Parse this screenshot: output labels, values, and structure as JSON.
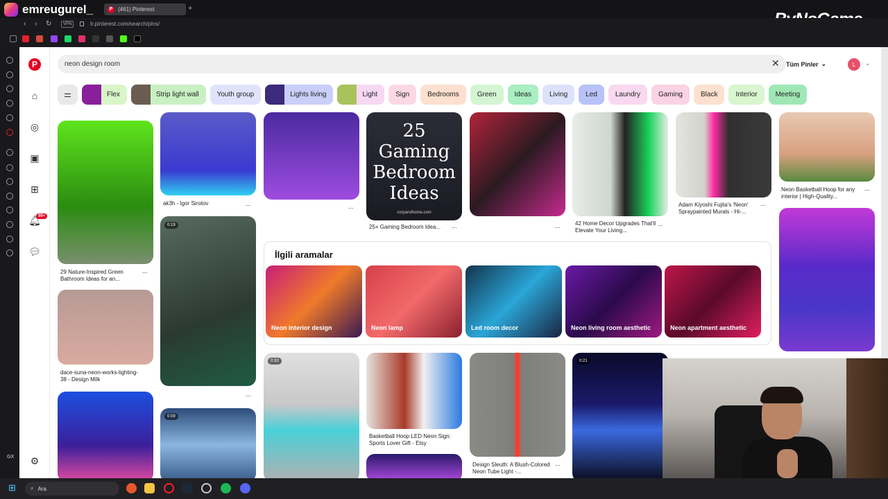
{
  "stream": {
    "channel": "emreugurel_",
    "overlay_brand": "ByNoGame"
  },
  "browser": {
    "tab_title": "(461) Pinterest",
    "new_tab": "+",
    "vpn": "VPN",
    "url": "tr.pinterest.com/search/pins/"
  },
  "pinterest": {
    "logo": "P",
    "search": {
      "value": "neon design room",
      "clear": "✕"
    },
    "filter_select": {
      "label": "Tüm Pinler",
      "chevron": "⌄"
    },
    "avatar": "L",
    "notifications_badge": "99+",
    "chips": [
      {
        "label": "Flex",
        "bg": "#d9f6c8",
        "thumb": "#8a1f9c"
      },
      {
        "label": "Strip light wall",
        "bg": "#c9f0c2",
        "thumb": "#6a5c50"
      },
      {
        "label": "Youth group",
        "bg": "#e0e3fb",
        "thumb": ""
      },
      {
        "label": "Lights living",
        "bg": "#c9cff8",
        "thumb": "#3c2a7a"
      },
      {
        "label": "Light",
        "bg": "#f7d8f3",
        "thumb": "#a9c35c"
      },
      {
        "label": "Sign",
        "bg": "#fbd9e4",
        "thumb": ""
      },
      {
        "label": "Bedrooms",
        "bg": "#fde0cf",
        "thumb": ""
      },
      {
        "label": "Green",
        "bg": "#d4f5d2",
        "thumb": ""
      },
      {
        "label": "Ideas",
        "bg": "#aaeec2",
        "thumb": ""
      },
      {
        "label": "Living",
        "bg": "#dde2fb",
        "thumb": ""
      },
      {
        "label": "Led",
        "bg": "#b8c2f7",
        "thumb": ""
      },
      {
        "label": "Laundry",
        "bg": "#f9d8f0",
        "thumb": ""
      },
      {
        "label": "Gaming",
        "bg": "#fbd3e2",
        "thumb": ""
      },
      {
        "label": "Black",
        "bg": "#fde0cf",
        "thumb": ""
      },
      {
        "label": "Interior",
        "bg": "#d8f6cf",
        "thumb": ""
      },
      {
        "label": "Meeting",
        "bg": "#9fe8b6",
        "thumb": ""
      }
    ],
    "pins": {
      "green_bathroom": "29 Nature-Inspired Green Bathroom Ideas for an...",
      "igor": "ak3h - Igor Sirotov",
      "gaming_bedroom": "25+ Gaming Bedroom Idea...",
      "home_decor": "42 Home Decor Upgrades That'll Elevate Your Living...",
      "fujita": "Adam Kiyoshi Fujita's 'Neon' Spraypainted Murals - Hi-...",
      "basketball_top": "Neon Basketball Hoop for any interior | High-Quality...",
      "dace": "dace-suna-neon-works-lighting-38 - Design Milk",
      "basketball_etsy": "Basketball Hoop LED Neon Sign: Sports Lover Gift - Etsy",
      "sleuth": "Design Sleuth: A Blush-Colored Neon Tube Light -...",
      "gaming_text_line1": "25",
      "gaming_text_line2": "Gaming",
      "gaming_text_line3": "Bedroom",
      "gaming_text_line4": "Ideas",
      "gaming_site": "coryandhome.com",
      "dots": "...",
      "dur_1": "0:19",
      "dur_2": "0:09",
      "dur_3": "0:32",
      "dur_4": "0:21"
    },
    "related": {
      "title": "İlgili aramalar",
      "items": [
        "Neon interior design",
        "Neon lamp",
        "Led room decor",
        "Neon living room aesthetic",
        "Neon apartment aesthetic"
      ]
    }
  },
  "taskbar": {
    "search": "Ara"
  },
  "gx": {
    "label": "GX"
  }
}
